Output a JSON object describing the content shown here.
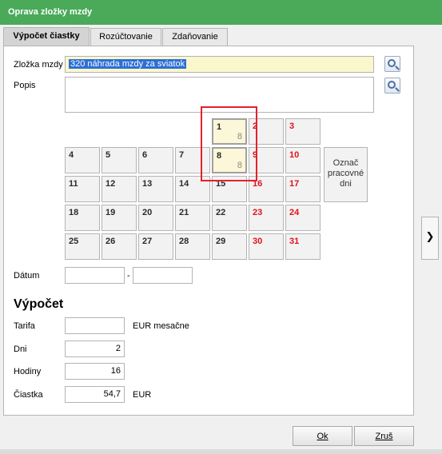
{
  "window": {
    "title": "Oprava zložky mzdy"
  },
  "tabs": [
    {
      "label": "Výpočet čiastky",
      "active": true
    },
    {
      "label": "Rozúčtovanie",
      "active": false
    },
    {
      "label": "Zdaňovanie",
      "active": false
    }
  ],
  "form": {
    "zlozka_label": "Zložka mzdy",
    "zlozka_value": "320  náhrada mzdy za sviatok",
    "popis_label": "Popis",
    "popis_value": "",
    "datum_label": "Dátum",
    "datum_from": "",
    "datum_separator": "-",
    "datum_to": ""
  },
  "calendar": {
    "days": [
      {
        "n": "1",
        "hrs": "8",
        "weekend": false,
        "selected": true
      },
      {
        "n": "2",
        "hrs": "",
        "weekend": true,
        "selected": false
      },
      {
        "n": "3",
        "hrs": "",
        "weekend": true,
        "selected": false
      },
      {
        "n": "4",
        "hrs": "",
        "weekend": false,
        "selected": false
      },
      {
        "n": "5",
        "hrs": "",
        "weekend": false,
        "selected": false
      },
      {
        "n": "6",
        "hrs": "",
        "weekend": false,
        "selected": false
      },
      {
        "n": "7",
        "hrs": "",
        "weekend": false,
        "selected": false
      },
      {
        "n": "8",
        "hrs": "8",
        "weekend": false,
        "selected": true
      },
      {
        "n": "9",
        "hrs": "",
        "weekend": true,
        "selected": false
      },
      {
        "n": "10",
        "hrs": "",
        "weekend": true,
        "selected": false
      },
      {
        "n": "11",
        "hrs": "",
        "weekend": false,
        "selected": false
      },
      {
        "n": "12",
        "hrs": "",
        "weekend": false,
        "selected": false
      },
      {
        "n": "13",
        "hrs": "",
        "weekend": false,
        "selected": false
      },
      {
        "n": "14",
        "hrs": "",
        "weekend": false,
        "selected": false
      },
      {
        "n": "15",
        "hrs": "",
        "weekend": false,
        "selected": false
      },
      {
        "n": "16",
        "hrs": "",
        "weekend": true,
        "selected": false
      },
      {
        "n": "17",
        "hrs": "",
        "weekend": true,
        "selected": false
      },
      {
        "n": "18",
        "hrs": "",
        "weekend": false,
        "selected": false
      },
      {
        "n": "19",
        "hrs": "",
        "weekend": false,
        "selected": false
      },
      {
        "n": "20",
        "hrs": "",
        "weekend": false,
        "selected": false
      },
      {
        "n": "21",
        "hrs": "",
        "weekend": false,
        "selected": false
      },
      {
        "n": "22",
        "hrs": "",
        "weekend": false,
        "selected": false
      },
      {
        "n": "23",
        "hrs": "",
        "weekend": true,
        "selected": false
      },
      {
        "n": "24",
        "hrs": "",
        "weekend": true,
        "selected": false
      },
      {
        "n": "25",
        "hrs": "",
        "weekend": false,
        "selected": false
      },
      {
        "n": "26",
        "hrs": "",
        "weekend": false,
        "selected": false
      },
      {
        "n": "27",
        "hrs": "",
        "weekend": false,
        "selected": false
      },
      {
        "n": "28",
        "hrs": "",
        "weekend": false,
        "selected": false
      },
      {
        "n": "29",
        "hrs": "",
        "weekend": false,
        "selected": false
      },
      {
        "n": "30",
        "hrs": "",
        "weekend": true,
        "selected": false
      },
      {
        "n": "31",
        "hrs": "",
        "weekend": true,
        "selected": false
      }
    ],
    "mark_button_label": "Označ pracovné dni"
  },
  "vypocet": {
    "title": "Výpočet",
    "tarifa_label": "Tarifa",
    "tarifa_value": "",
    "tarifa_unit": "EUR mesačne",
    "dni_label": "Dni",
    "dni_value": "2",
    "hodiny_label": "Hodiny",
    "hodiny_value": "16",
    "ciastka_label": "Čiastka",
    "ciastka_value": "54,7",
    "ciastka_unit": "EUR"
  },
  "buttons": {
    "ok_label": "Ok",
    "cancel_label": "Zruš"
  },
  "colors": {
    "titlebar": "#4aaa5a",
    "weekend": "#e0121a",
    "highlight": "#e4212a"
  }
}
